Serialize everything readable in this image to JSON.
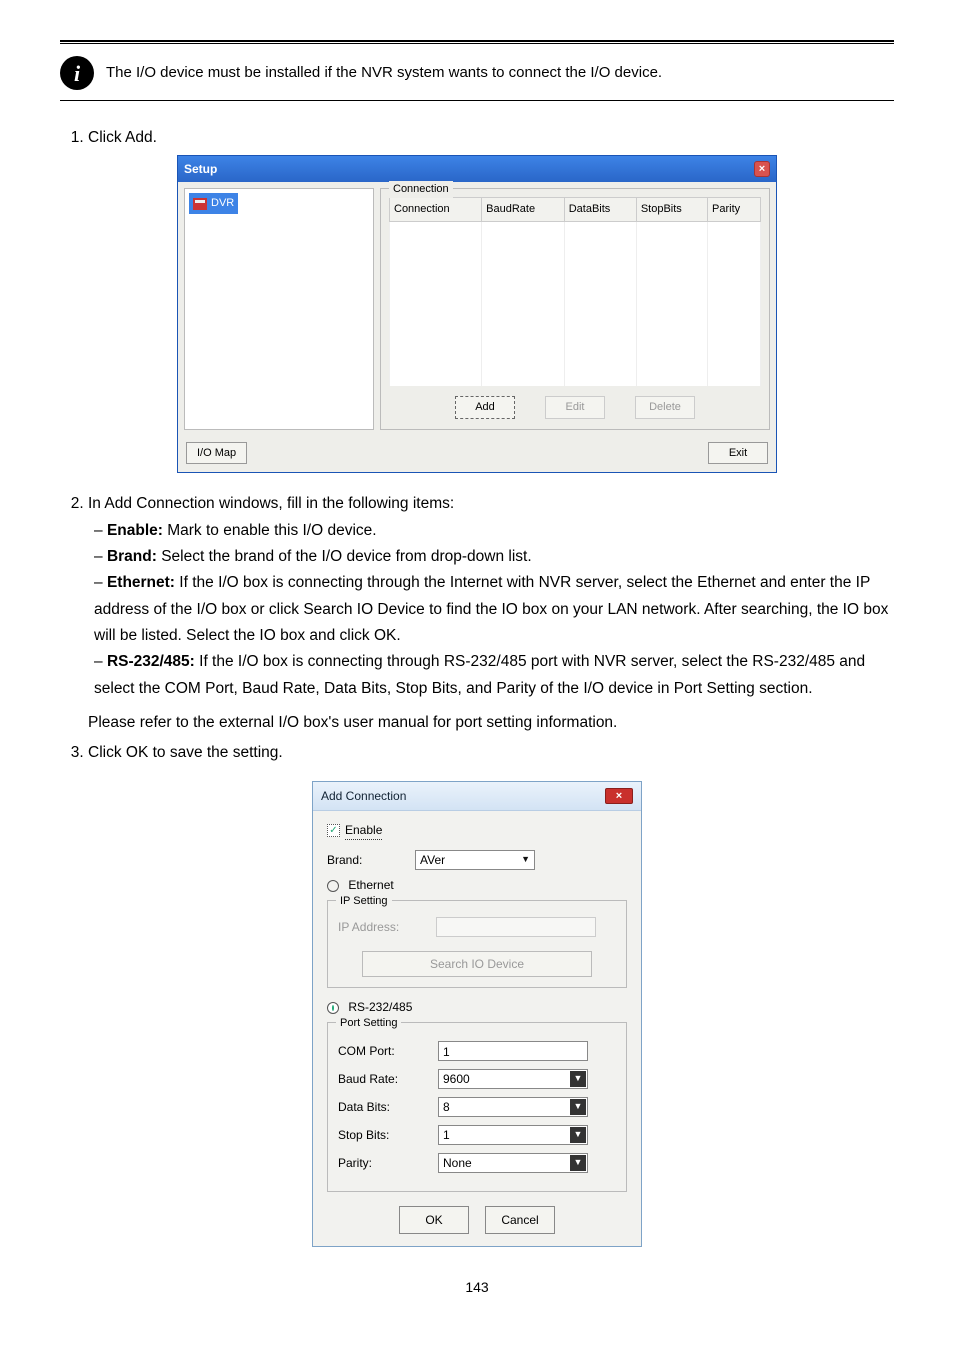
{
  "note": "The I/O device must be installed if the NVR system wants to connect the I/O device.",
  "steps": {
    "s1": "Click Add.",
    "s2_intro": "In Add Connection windows, fill in the following items:",
    "s2_items": {
      "enable_label": "Enable:",
      "enable_desc": " Mark to enable this I/O device.",
      "brand_label": "Brand:",
      "brand_desc": " Select the brand of the I/O device from drop-down list.",
      "ethernet_label": "Ethernet:",
      "ethernet_desc": " If the I/O box is connecting through the Internet with NVR server, select the Ethernet and enter the IP address of the I/O box or click Search IO Device to find the IO box on your LAN network. After searching, the IO box will be listed. Select the IO box and click OK.",
      "rs_label": "RS-232/485:",
      "rs_desc1": " If the I/O box is connecting through RS-232/485 port with NVR server, select the RS-232/485 and select the COM Port, Baud Rate, Data Bits, Stop Bits, and Parity of the I/O device in Port Setting section.",
      "rs_desc2": "Please refer to the external I/O box's user manual for port setting information."
    },
    "s3": "Click OK to save the setting."
  },
  "setup_window": {
    "title": "Setup",
    "tree_root": "DVR",
    "group_label": "Connection",
    "columns": [
      "Connection",
      "BaudRate",
      "DataBits",
      "StopBits",
      "Parity"
    ],
    "buttons": {
      "add": "Add",
      "edit": "Edit",
      "delete": "Delete"
    },
    "footer": {
      "io_map": "I/O Map",
      "exit": "Exit"
    }
  },
  "add_connection": {
    "title": "Add Connection",
    "enable_label": "Enable",
    "brand_label": "Brand:",
    "brand_value": "AVer",
    "ethernet_label": "Ethernet",
    "ip_group": "IP Setting",
    "ip_label": "IP Address:",
    "search_btn": "Search IO Device",
    "rs_label": "RS-232/485",
    "port_group": "Port Setting",
    "fields": {
      "com_port_label": "COM Port:",
      "com_port_value": "1",
      "baud_label": "Baud Rate:",
      "baud_value": "9600",
      "data_label": "Data Bits:",
      "data_value": "8",
      "stop_label": "Stop Bits:",
      "stop_value": "1",
      "parity_label": "Parity:",
      "parity_value": "None"
    },
    "ok": "OK",
    "cancel": "Cancel"
  },
  "page_number": "143"
}
